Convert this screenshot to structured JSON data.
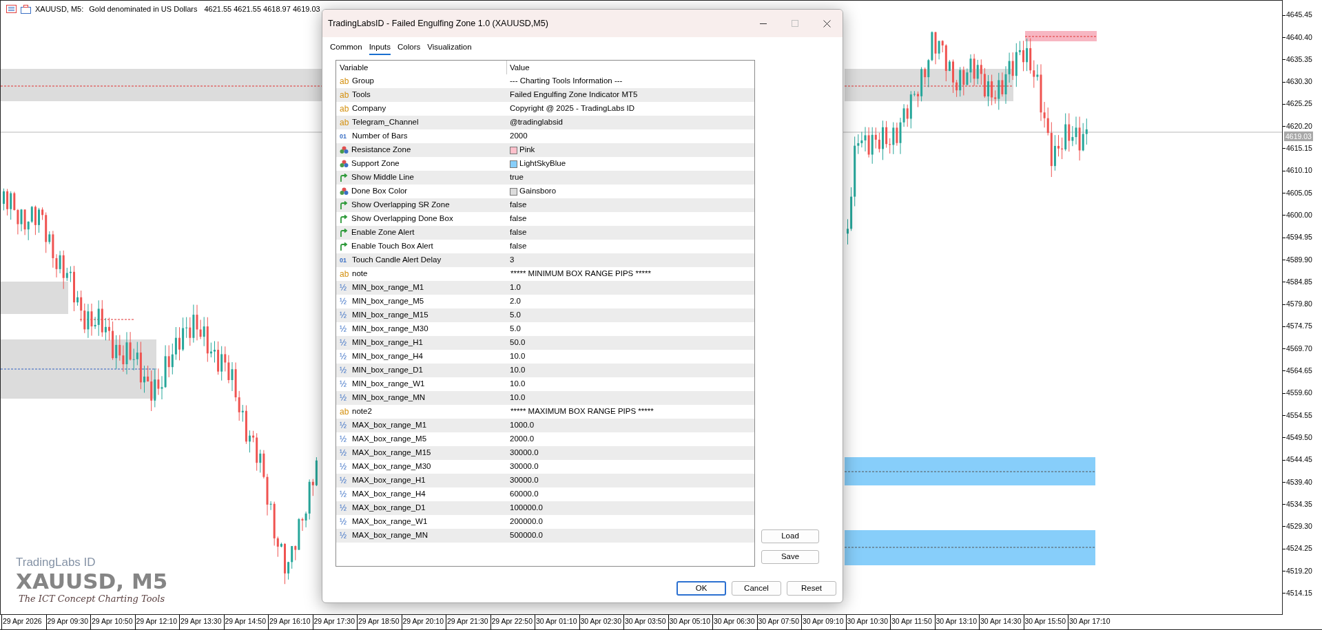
{
  "chart_header": {
    "symbol": "XAUUSD, M5:",
    "description": "Gold denominated in US Dollars",
    "prices": "4621.55 4621.55 4618.97 4619.03"
  },
  "chart_overlay": {
    "brand": "TradingLabs ID",
    "symbol": "XAUUSD, M5",
    "tagline": "The ICT Concept Charting Tools"
  },
  "price_axis": {
    "labels": [
      "4645.45",
      "4640.40",
      "4635.35",
      "4630.30",
      "4625.25",
      "4620.20",
      "4615.15",
      "4610.10",
      "4605.05",
      "4600.00",
      "4594.95",
      "4589.90",
      "4584.85",
      "4579.80",
      "4574.75",
      "4569.70",
      "4564.65",
      "4559.60",
      "4554.55",
      "4549.50",
      "4544.45",
      "4539.40",
      "4534.35",
      "4529.30",
      "4524.25",
      "4519.20",
      "4514.15"
    ],
    "current_price": "4619.03"
  },
  "time_axis": [
    "29 Apr 2026",
    "29 Apr 09:30",
    "29 Apr 10:50",
    "29 Apr 12:10",
    "29 Apr 13:30",
    "29 Apr 14:50",
    "29 Apr 16:10",
    "29 Apr 17:30",
    "29 Apr 18:50",
    "29 Apr 20:10",
    "29 Apr 21:30",
    "29 Apr 22:50",
    "30 Apr 01:10",
    "30 Apr 02:30",
    "30 Apr 03:50",
    "30 Apr 05:10",
    "30 Apr 06:30",
    "30 Apr 07:50",
    "30 Apr 09:10",
    "30 Apr 10:30",
    "30 Apr 11:50",
    "30 Apr 13:10",
    "30 Apr 14:30",
    "30 Apr 15:50",
    "30 Apr 17:10"
  ],
  "dialog": {
    "title": "TradingLabsID - Failed Engulfing Zone 1.0 (XAUUSD,M5)",
    "tabs": [
      {
        "label": "Common",
        "selected": false
      },
      {
        "label": "Inputs",
        "selected": true
      },
      {
        "label": "Colors",
        "selected": false
      },
      {
        "label": "Visualization",
        "selected": false
      }
    ],
    "columns": [
      "Variable",
      "Value"
    ],
    "rows": [
      {
        "kind": "string",
        "icon": "ab",
        "variable": "Group",
        "value": "--- Charting Tools Information ---"
      },
      {
        "kind": "string",
        "icon": "ab",
        "variable": "Tools",
        "value": "Failed Engulfing Zone Indicator MT5"
      },
      {
        "kind": "string",
        "icon": "ab",
        "variable": "Company",
        "value": "Copyright @ 2025 - TradingLabs ID"
      },
      {
        "kind": "string",
        "icon": "ab",
        "variable": "Telegram_Channel",
        "value": "@tradinglabsid"
      },
      {
        "kind": "int",
        "icon": "01",
        "variable": "Number of Bars",
        "value": "2000"
      },
      {
        "kind": "color",
        "variable": "Resistance Zone",
        "value": "Pink",
        "color": "#ffc0cb"
      },
      {
        "kind": "color",
        "variable": "Support Zone",
        "value": "LightSkyBlue",
        "color": "#87cefa"
      },
      {
        "kind": "bool",
        "variable": "Show Middle Line",
        "value": "true"
      },
      {
        "kind": "color",
        "variable": "Done Box Color",
        "value": "Gainsboro",
        "color": "#dcdcdc"
      },
      {
        "kind": "bool",
        "variable": "Show Overlapping SR Zone",
        "value": "false"
      },
      {
        "kind": "bool",
        "variable": "Show Overlapping Done Box",
        "value": "false"
      },
      {
        "kind": "bool",
        "variable": "Enable Zone Alert",
        "value": "false"
      },
      {
        "kind": "bool",
        "variable": "Enable Touch Box Alert",
        "value": "false"
      },
      {
        "kind": "int",
        "icon": "01",
        "variable": "Touch Candle Alert Delay",
        "value": "3"
      },
      {
        "kind": "string",
        "icon": "ab",
        "variable": "note",
        "value": "***** MINIMUM BOX RANGE PIPS *****"
      },
      {
        "kind": "double",
        "icon": "½",
        "variable": "MIN_box_range_M1",
        "value": "1.0"
      },
      {
        "kind": "double",
        "icon": "½",
        "variable": "MIN_box_range_M5",
        "value": "2.0"
      },
      {
        "kind": "double",
        "icon": "½",
        "variable": "MIN_box_range_M15",
        "value": "5.0"
      },
      {
        "kind": "double",
        "icon": "½",
        "variable": "MIN_box_range_M30",
        "value": "5.0"
      },
      {
        "kind": "double",
        "icon": "½",
        "variable": "MIN_box_range_H1",
        "value": "50.0"
      },
      {
        "kind": "double",
        "icon": "½",
        "variable": "MIN_box_range_H4",
        "value": "10.0"
      },
      {
        "kind": "double",
        "icon": "½",
        "variable": "MIN_box_range_D1",
        "value": "10.0"
      },
      {
        "kind": "double",
        "icon": "½",
        "variable": "MIN_box_range_W1",
        "value": "10.0"
      },
      {
        "kind": "double",
        "icon": "½",
        "variable": "MIN_box_range_MN",
        "value": "10.0"
      },
      {
        "kind": "string",
        "icon": "ab",
        "variable": "note2",
        "value": "***** MAXIMUM BOX RANGE PIPS *****"
      },
      {
        "kind": "double",
        "icon": "½",
        "variable": "MAX_box_range_M1",
        "value": "1000.0"
      },
      {
        "kind": "double",
        "icon": "½",
        "variable": "MAX_box_range_M5",
        "value": "2000.0"
      },
      {
        "kind": "double",
        "icon": "½",
        "variable": "MAX_box_range_M15",
        "value": "30000.0"
      },
      {
        "kind": "double",
        "icon": "½",
        "variable": "MAX_box_range_M30",
        "value": "30000.0"
      },
      {
        "kind": "double",
        "icon": "½",
        "variable": "MAX_box_range_H1",
        "value": "30000.0"
      },
      {
        "kind": "double",
        "icon": "½",
        "variable": "MAX_box_range_H4",
        "value": "60000.0"
      },
      {
        "kind": "double",
        "icon": "½",
        "variable": "MAX_box_range_D1",
        "value": "100000.0"
      },
      {
        "kind": "double",
        "icon": "½",
        "variable": "MAX_box_range_W1",
        "value": "200000.0"
      },
      {
        "kind": "double",
        "icon": "½",
        "variable": "MAX_box_range_MN",
        "value": "500000.0"
      }
    ],
    "side_buttons": [
      "Load",
      "Save"
    ],
    "buttons": [
      {
        "label": "OK",
        "default": true
      },
      {
        "label": "Cancel",
        "default": false
      },
      {
        "label": "Reset",
        "default": false
      }
    ]
  }
}
